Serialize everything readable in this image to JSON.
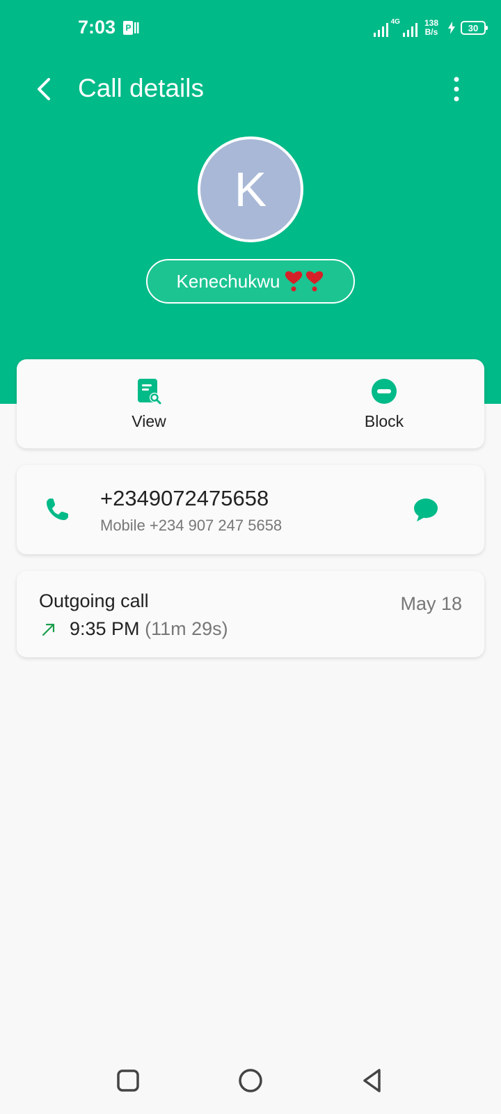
{
  "status_bar": {
    "time": "7:03",
    "network_type": "4G",
    "net_speed_value": "138",
    "net_speed_unit": "B/s",
    "battery_level": "30"
  },
  "app_bar": {
    "title": "Call details"
  },
  "contact": {
    "avatar_initial": "K",
    "name": "Kenechukwu"
  },
  "actions": {
    "view_label": "View",
    "block_label": "Block"
  },
  "phone": {
    "number": "+2349072475658",
    "subtitle": "Mobile +234 907 247 5658"
  },
  "history": {
    "call_type": "Outgoing call",
    "time": "9:35 PM",
    "duration": "(11m 29s)",
    "date": "May 18"
  },
  "colors": {
    "accent": "#00ba88",
    "avatar_bg": "#a9b8d6",
    "outgoing_arrow": "#1a9e4a"
  }
}
